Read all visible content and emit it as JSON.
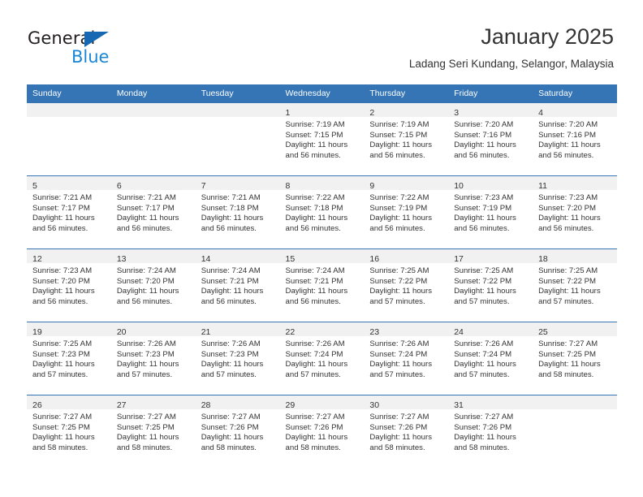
{
  "brand": {
    "name_top": "General",
    "name_bottom": "Blue",
    "triangle_icon": "triangle-icon",
    "color_dark": "#231f20",
    "color_blue": "#1b87d4",
    "color_triangle": "#1668b3"
  },
  "header": {
    "title": "January 2025",
    "subtitle": "Ladang Seri Kundang, Selangor, Malaysia"
  },
  "theme": {
    "header_bg": "#3575b5",
    "header_text": "#ffffff",
    "daynum_band_bg": "#f1f1f1",
    "grid_line": "#3575b5",
    "body_text": "#333333"
  },
  "calendar": {
    "weekday_headers": [
      "Sunday",
      "Monday",
      "Tuesday",
      "Wednesday",
      "Thursday",
      "Friday",
      "Saturday"
    ],
    "weeks": [
      [
        {
          "empty": true
        },
        {
          "empty": true
        },
        {
          "empty": true
        },
        {
          "day": "1",
          "sunrise": "Sunrise: 7:19 AM",
          "sunset": "Sunset: 7:15 PM",
          "daylight_1": "Daylight: 11 hours",
          "daylight_2": "and 56 minutes."
        },
        {
          "day": "2",
          "sunrise": "Sunrise: 7:19 AM",
          "sunset": "Sunset: 7:15 PM",
          "daylight_1": "Daylight: 11 hours",
          "daylight_2": "and 56 minutes."
        },
        {
          "day": "3",
          "sunrise": "Sunrise: 7:20 AM",
          "sunset": "Sunset: 7:16 PM",
          "daylight_1": "Daylight: 11 hours",
          "daylight_2": "and 56 minutes."
        },
        {
          "day": "4",
          "sunrise": "Sunrise: 7:20 AM",
          "sunset": "Sunset: 7:16 PM",
          "daylight_1": "Daylight: 11 hours",
          "daylight_2": "and 56 minutes."
        }
      ],
      [
        {
          "day": "5",
          "sunrise": "Sunrise: 7:21 AM",
          "sunset": "Sunset: 7:17 PM",
          "daylight_1": "Daylight: 11 hours",
          "daylight_2": "and 56 minutes."
        },
        {
          "day": "6",
          "sunrise": "Sunrise: 7:21 AM",
          "sunset": "Sunset: 7:17 PM",
          "daylight_1": "Daylight: 11 hours",
          "daylight_2": "and 56 minutes."
        },
        {
          "day": "7",
          "sunrise": "Sunrise: 7:21 AM",
          "sunset": "Sunset: 7:18 PM",
          "daylight_1": "Daylight: 11 hours",
          "daylight_2": "and 56 minutes."
        },
        {
          "day": "8",
          "sunrise": "Sunrise: 7:22 AM",
          "sunset": "Sunset: 7:18 PM",
          "daylight_1": "Daylight: 11 hours",
          "daylight_2": "and 56 minutes."
        },
        {
          "day": "9",
          "sunrise": "Sunrise: 7:22 AM",
          "sunset": "Sunset: 7:19 PM",
          "daylight_1": "Daylight: 11 hours",
          "daylight_2": "and 56 minutes."
        },
        {
          "day": "10",
          "sunrise": "Sunrise: 7:23 AM",
          "sunset": "Sunset: 7:19 PM",
          "daylight_1": "Daylight: 11 hours",
          "daylight_2": "and 56 minutes."
        },
        {
          "day": "11",
          "sunrise": "Sunrise: 7:23 AM",
          "sunset": "Sunset: 7:20 PM",
          "daylight_1": "Daylight: 11 hours",
          "daylight_2": "and 56 minutes."
        }
      ],
      [
        {
          "day": "12",
          "sunrise": "Sunrise: 7:23 AM",
          "sunset": "Sunset: 7:20 PM",
          "daylight_1": "Daylight: 11 hours",
          "daylight_2": "and 56 minutes."
        },
        {
          "day": "13",
          "sunrise": "Sunrise: 7:24 AM",
          "sunset": "Sunset: 7:20 PM",
          "daylight_1": "Daylight: 11 hours",
          "daylight_2": "and 56 minutes."
        },
        {
          "day": "14",
          "sunrise": "Sunrise: 7:24 AM",
          "sunset": "Sunset: 7:21 PM",
          "daylight_1": "Daylight: 11 hours",
          "daylight_2": "and 56 minutes."
        },
        {
          "day": "15",
          "sunrise": "Sunrise: 7:24 AM",
          "sunset": "Sunset: 7:21 PM",
          "daylight_1": "Daylight: 11 hours",
          "daylight_2": "and 56 minutes."
        },
        {
          "day": "16",
          "sunrise": "Sunrise: 7:25 AM",
          "sunset": "Sunset: 7:22 PM",
          "daylight_1": "Daylight: 11 hours",
          "daylight_2": "and 57 minutes."
        },
        {
          "day": "17",
          "sunrise": "Sunrise: 7:25 AM",
          "sunset": "Sunset: 7:22 PM",
          "daylight_1": "Daylight: 11 hours",
          "daylight_2": "and 57 minutes."
        },
        {
          "day": "18",
          "sunrise": "Sunrise: 7:25 AM",
          "sunset": "Sunset: 7:22 PM",
          "daylight_1": "Daylight: 11 hours",
          "daylight_2": "and 57 minutes."
        }
      ],
      [
        {
          "day": "19",
          "sunrise": "Sunrise: 7:25 AM",
          "sunset": "Sunset: 7:23 PM",
          "daylight_1": "Daylight: 11 hours",
          "daylight_2": "and 57 minutes."
        },
        {
          "day": "20",
          "sunrise": "Sunrise: 7:26 AM",
          "sunset": "Sunset: 7:23 PM",
          "daylight_1": "Daylight: 11 hours",
          "daylight_2": "and 57 minutes."
        },
        {
          "day": "21",
          "sunrise": "Sunrise: 7:26 AM",
          "sunset": "Sunset: 7:23 PM",
          "daylight_1": "Daylight: 11 hours",
          "daylight_2": "and 57 minutes."
        },
        {
          "day": "22",
          "sunrise": "Sunrise: 7:26 AM",
          "sunset": "Sunset: 7:24 PM",
          "daylight_1": "Daylight: 11 hours",
          "daylight_2": "and 57 minutes."
        },
        {
          "day": "23",
          "sunrise": "Sunrise: 7:26 AM",
          "sunset": "Sunset: 7:24 PM",
          "daylight_1": "Daylight: 11 hours",
          "daylight_2": "and 57 minutes."
        },
        {
          "day": "24",
          "sunrise": "Sunrise: 7:26 AM",
          "sunset": "Sunset: 7:24 PM",
          "daylight_1": "Daylight: 11 hours",
          "daylight_2": "and 57 minutes."
        },
        {
          "day": "25",
          "sunrise": "Sunrise: 7:27 AM",
          "sunset": "Sunset: 7:25 PM",
          "daylight_1": "Daylight: 11 hours",
          "daylight_2": "and 58 minutes."
        }
      ],
      [
        {
          "day": "26",
          "sunrise": "Sunrise: 7:27 AM",
          "sunset": "Sunset: 7:25 PM",
          "daylight_1": "Daylight: 11 hours",
          "daylight_2": "and 58 minutes."
        },
        {
          "day": "27",
          "sunrise": "Sunrise: 7:27 AM",
          "sunset": "Sunset: 7:25 PM",
          "daylight_1": "Daylight: 11 hours",
          "daylight_2": "and 58 minutes."
        },
        {
          "day": "28",
          "sunrise": "Sunrise: 7:27 AM",
          "sunset": "Sunset: 7:26 PM",
          "daylight_1": "Daylight: 11 hours",
          "daylight_2": "and 58 minutes."
        },
        {
          "day": "29",
          "sunrise": "Sunrise: 7:27 AM",
          "sunset": "Sunset: 7:26 PM",
          "daylight_1": "Daylight: 11 hours",
          "daylight_2": "and 58 minutes."
        },
        {
          "day": "30",
          "sunrise": "Sunrise: 7:27 AM",
          "sunset": "Sunset: 7:26 PM",
          "daylight_1": "Daylight: 11 hours",
          "daylight_2": "and 58 minutes."
        },
        {
          "day": "31",
          "sunrise": "Sunrise: 7:27 AM",
          "sunset": "Sunset: 7:26 PM",
          "daylight_1": "Daylight: 11 hours",
          "daylight_2": "and 58 minutes."
        },
        {
          "empty": true
        }
      ]
    ]
  }
}
